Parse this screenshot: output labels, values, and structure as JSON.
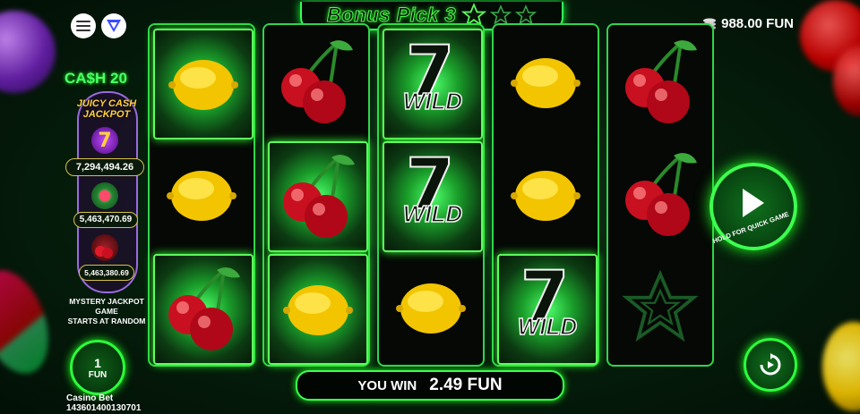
{
  "header": {
    "title": "Bonus Pick 3",
    "balance": "988.00 FUN"
  },
  "left_panel": {
    "game_name": "CA$H 20",
    "jackpot_title_line1": "JUICY CASH",
    "jackpot_title_line2": "JACKPOT",
    "jackpots": [
      {
        "value": "7,294,494.26",
        "icon": "seven-icon"
      },
      {
        "value": "5,463,470.69",
        "icon": "watermelon-icon"
      },
      {
        "value": "5,463,380.69",
        "icon": "cherry-icon"
      }
    ],
    "mystery_line1": "MYSTERY JACKPOT GAME",
    "mystery_line2": "STARTS AT RANDOM",
    "bet_value": "1",
    "bet_currency": "FUN",
    "casino_label": "Casino Bet",
    "casino_id": "143601400130701"
  },
  "reels": [
    [
      "lemon",
      "lemon",
      "cherry"
    ],
    [
      "cherry",
      "cherry",
      "lemon"
    ],
    [
      "wild",
      "wild",
      "lemon"
    ],
    [
      "lemon",
      "lemon",
      "wild"
    ],
    [
      "cherry",
      "cherry",
      "star"
    ]
  ],
  "win": {
    "label": "YOU WIN",
    "amount": "2.49 FUN"
  },
  "play_button": {
    "hint": "HOLD FOR QUICK GAME"
  },
  "wild_text": "WILD",
  "wild_number": "7",
  "colors": {
    "neon_green": "#33ff55",
    "gold": "#ffd23a"
  }
}
